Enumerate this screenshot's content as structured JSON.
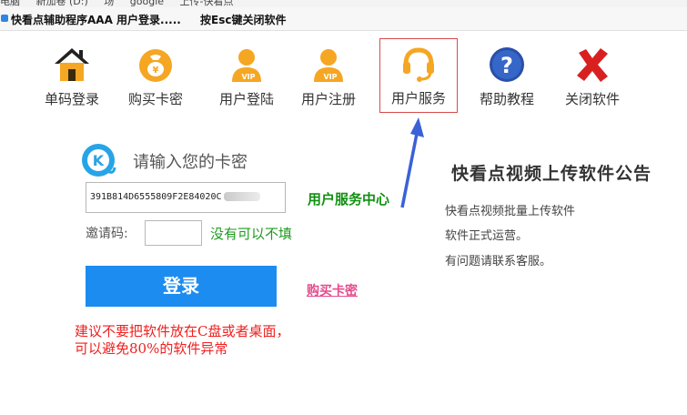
{
  "breadcrumb": [
    "电脑",
    "新加卷 (D:)",
    "场",
    "google",
    "上传-快看点"
  ],
  "window": {
    "title": "快看点辅助程序AAA  用户登录.....",
    "hint": "按Esc键关闭软件"
  },
  "toolbar": [
    {
      "label": "单码登录",
      "icon": "home-icon"
    },
    {
      "label": "购买卡密",
      "icon": "money-bag-icon"
    },
    {
      "label": "用户登陆",
      "icon": "vip-user-icon"
    },
    {
      "label": "用户注册",
      "icon": "vip-user-icon"
    },
    {
      "label": "用户服务",
      "icon": "headset-icon",
      "active": true
    },
    {
      "label": "帮助教程",
      "icon": "help-icon"
    },
    {
      "label": "关闭软件",
      "icon": "close-icon"
    }
  ],
  "login": {
    "prompt": "请输入您的卡密",
    "card_value": "391B814D6555809F2E84020C",
    "invite_label": "邀请码:",
    "invite_value": "",
    "invite_hint": "没有可以不填",
    "login_label": "登录",
    "buy_link": "购买卡密",
    "service_center": "用户服务中心"
  },
  "warning": [
    "建议不要把软件放在C盘或者桌面，",
    "可以避免80%的软件异常"
  ],
  "notice": {
    "title": "快看点视频上传软件公告",
    "lines": [
      "快看点视频批量上传软件",
      "软件正式运营。",
      "有问题请联系客服。"
    ]
  },
  "colors": {
    "login_button": "#1c8cf0",
    "highlight_border": "#d64b4b",
    "warning_text": "#ef1f1f",
    "hint_text": "#1e9a1e",
    "link": "#e44c8d",
    "icon_orange": "#f5a623"
  }
}
